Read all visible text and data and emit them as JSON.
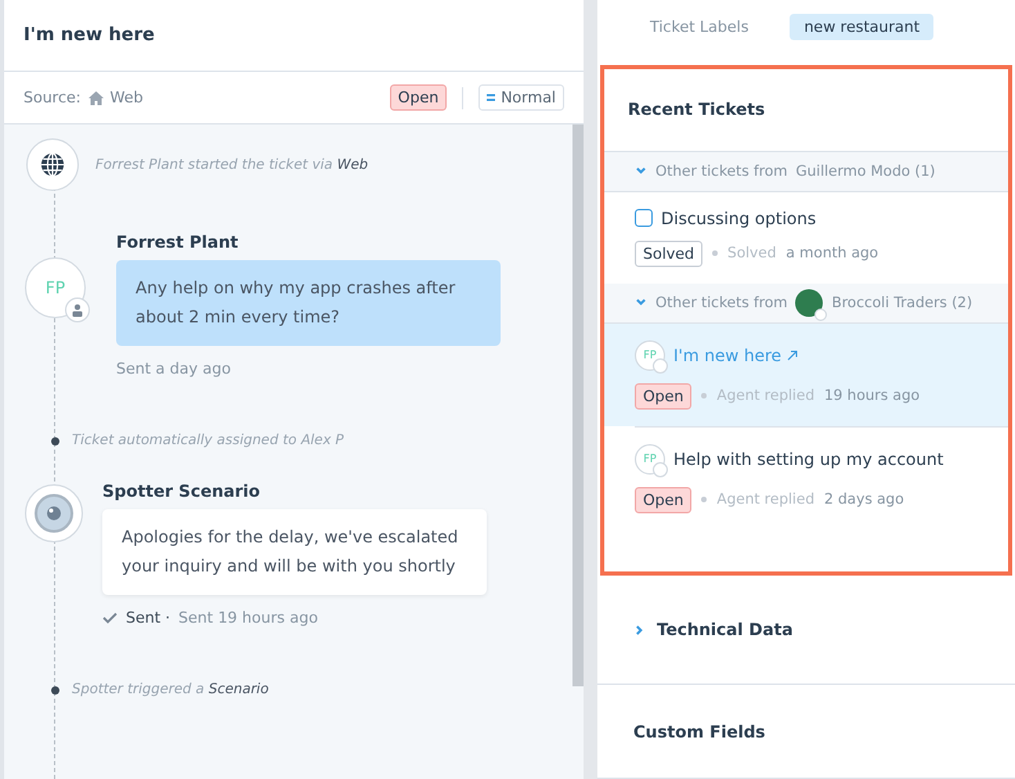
{
  "ticket": {
    "title": "I'm new here",
    "source_label": "Source:",
    "source": "Web",
    "status": {
      "label": "Open",
      "kind": "open"
    },
    "priority": "Normal"
  },
  "timeline": [
    {
      "kind": "event",
      "text": "Forrest Plant started the ticket via **Web**"
    },
    {
      "kind": "customer_message",
      "author": "Forrest Plant",
      "initials": "FP",
      "text": "Any help on why my app crashes after about 2 min every time?",
      "footer": "Sent a day ago"
    },
    {
      "kind": "note",
      "text": "Ticket automatically assigned to Alex P"
    },
    {
      "kind": "bot_message",
      "author": "Spotter Scenario",
      "text": "Apologies for the delay, we've escalated your inquiry and will be with you shortly",
      "delivery": "Sent ·",
      "footer": "Sent 19 hours ago"
    },
    {
      "kind": "note",
      "text": "Spotter triggered a **Scenario**"
    }
  ],
  "labels": {
    "label": "Ticket Labels",
    "items": [
      "new restaurant"
    ]
  },
  "recent_tickets": {
    "title": "Recent Tickets",
    "groups": [
      {
        "prefix": "Other tickets from",
        "name": "Guillermo Modo (1)",
        "org_avatar": false,
        "expanded": true,
        "tickets": [
          {
            "kind": "checkbox",
            "title": "Discussing options",
            "link": false,
            "selected": false,
            "status": {
              "label": "Solved",
              "kind": "solved"
            },
            "meta_label": "Solved",
            "meta_time": "a month ago"
          }
        ]
      },
      {
        "prefix": "Other tickets from",
        "name": "Broccoli Traders (2)",
        "org_avatar": true,
        "expanded": true,
        "tickets": [
          {
            "kind": "avatar",
            "initials": "FP",
            "title": "I'm new here",
            "link": true,
            "selected": true,
            "status": {
              "label": "Open",
              "kind": "open"
            },
            "meta_label": "Agent replied",
            "meta_time": "19 hours ago"
          },
          {
            "kind": "avatar",
            "initials": "FP",
            "title": "Help with setting up my account",
            "link": false,
            "selected": false,
            "status": {
              "label": "Open",
              "kind": "open"
            },
            "meta_label": "Agent replied",
            "meta_time": "2 days ago"
          }
        ]
      }
    ]
  },
  "sections": [
    {
      "title": "Technical Data",
      "collapsible": true,
      "expanded": false
    },
    {
      "title": "Custom Fields",
      "collapsible": false
    }
  ]
}
